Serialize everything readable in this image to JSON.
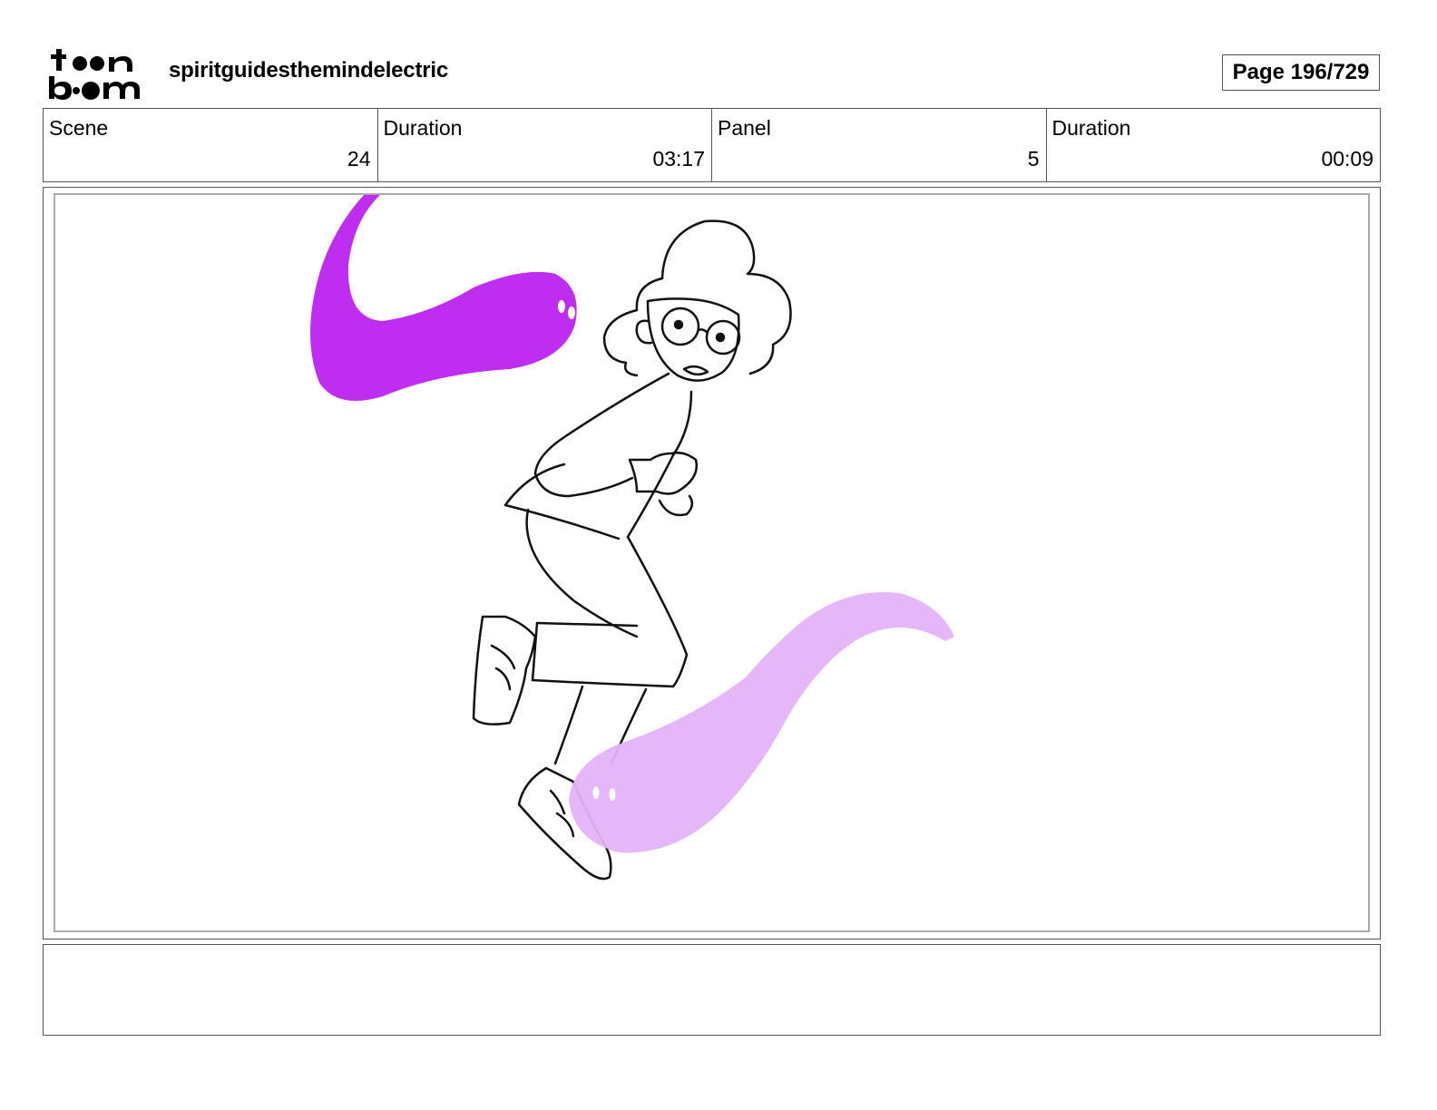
{
  "header": {
    "logo_text": "toon boom",
    "project_title": "spiritguidesthemindelectric",
    "page_label": "Page 196/729"
  },
  "info": {
    "scene_label": "Scene",
    "scene_value": "24",
    "scene_duration_label": "Duration",
    "scene_duration_value": "03:17",
    "panel_label": "Panel",
    "panel_value": "5",
    "panel_duration_label": "Duration",
    "panel_duration_value": "00:09"
  },
  "colors": {
    "spirit_dark": "#bf2ef0",
    "spirit_light": "#e4b2f8",
    "ink": "#111111"
  },
  "notes": {
    "text": ""
  }
}
